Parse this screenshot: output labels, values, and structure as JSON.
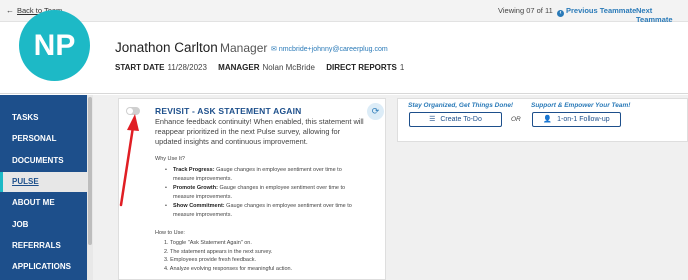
{
  "topbar": {
    "back_label": "Back to Team",
    "viewing": "Viewing 07 of 11",
    "previous_label": "Previous Teammate",
    "next_label": "Next Teammate"
  },
  "profile": {
    "initials": "NP",
    "name": "Jonathon Carlton",
    "role": "Manager",
    "email": "nmcbride+johnny@careerplug.com",
    "start_date_label": "START DATE",
    "start_date": "11/28/2023",
    "manager_label": "MANAGER",
    "manager": "Nolan McBride",
    "direct_reports_label": "DIRECT REPORTS",
    "direct_reports": "1"
  },
  "sidebar": {
    "items": [
      {
        "label": "TASKS"
      },
      {
        "label": "PERSONAL"
      },
      {
        "label": "DOCUMENTS"
      },
      {
        "label": "PULSE"
      },
      {
        "label": "ABOUT ME"
      },
      {
        "label": "JOB"
      },
      {
        "label": "REFERRALS"
      },
      {
        "label": "APPLICATIONS"
      }
    ],
    "active": "PULSE"
  },
  "card": {
    "title": "REVISIT - ASK STATEMENT AGAIN",
    "toggle_state": "off",
    "description": "Enhance feedback continuity! When enabled, this statement will reappear prioritized in the next Pulse survey, allowing for updated insights and continuous improvement.",
    "why_heading": "Why Use It?",
    "why_items": [
      {
        "term": "Track Progress:",
        "text": "Gauge changes in employee sentiment over time to measure improvements."
      },
      {
        "term": "Promote Growth:",
        "text": "Gauge changes in employee sentiment over time to measure improvements."
      },
      {
        "term": "Show Commitment:",
        "text": "Gauge changes in employee sentiment over time to measure improvements."
      }
    ],
    "how_heading": "How to Use:",
    "how_steps": [
      "1. Toggle \"Ask Statement Again\" on.",
      "2. The statement appears in the next survey.",
      "3. Employees provide fresh feedback.",
      "4. Analyze evolving responses for meaningful action."
    ]
  },
  "actions": {
    "left_heading": "Stay Organized, Get Things Done!",
    "create_todo_label": "Create To-Do",
    "or_label": "OR",
    "right_heading": "Support & Empower Your Team!",
    "followup_label": "1-on-1 Follow-up"
  },
  "colors": {
    "brand_navy": "#1d4f8b",
    "accent_teal": "#1db9c6",
    "link_blue": "#2a7ab8",
    "annotation_red": "#e01e24"
  }
}
